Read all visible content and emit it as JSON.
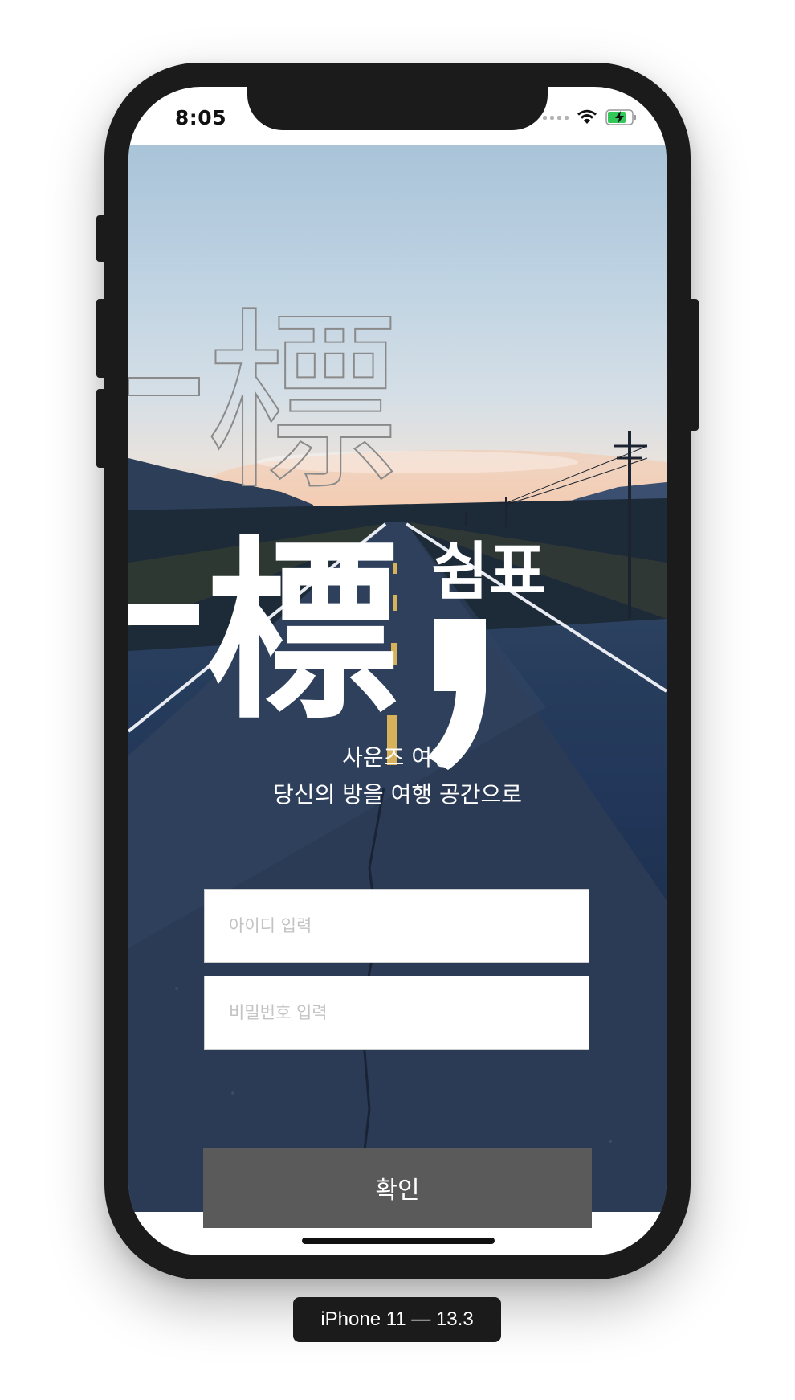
{
  "status_bar": {
    "time": "8:05",
    "signal_icon": "signal-dots-icon",
    "wifi_icon": "wifi-icon",
    "battery_icon": "battery-charging-icon",
    "battery_color": "#34c759"
  },
  "brand": {
    "hanja": "標",
    "comma": ",",
    "name_ko": "쉼표",
    "tagline_line1": "사운즈 여행",
    "tagline_line2": "당신의 방을 여행 공간으로"
  },
  "login": {
    "id_placeholder": "아이디 입력",
    "password_placeholder": "비밀번호 입력",
    "confirm_label": "확인",
    "confirm_color": "#5a5a5a"
  },
  "simulator": {
    "device_label": "iPhone 11 — 13.3"
  }
}
